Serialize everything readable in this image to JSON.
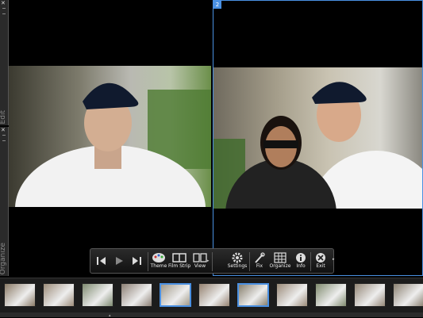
{
  "left_panels": {
    "edit": {
      "label": "Edit"
    },
    "organize": {
      "label": "Organize"
    }
  },
  "right_pane": {
    "number": "2"
  },
  "toolbar": {
    "theme": "Theme",
    "film_strip": "Film Strip",
    "view": "View",
    "settings": "Settings",
    "fix": "Fix",
    "organize": "Organize",
    "info": "Info",
    "exit": "Exit"
  },
  "filmstrip": {
    "selected_indices": [
      4,
      6
    ]
  }
}
